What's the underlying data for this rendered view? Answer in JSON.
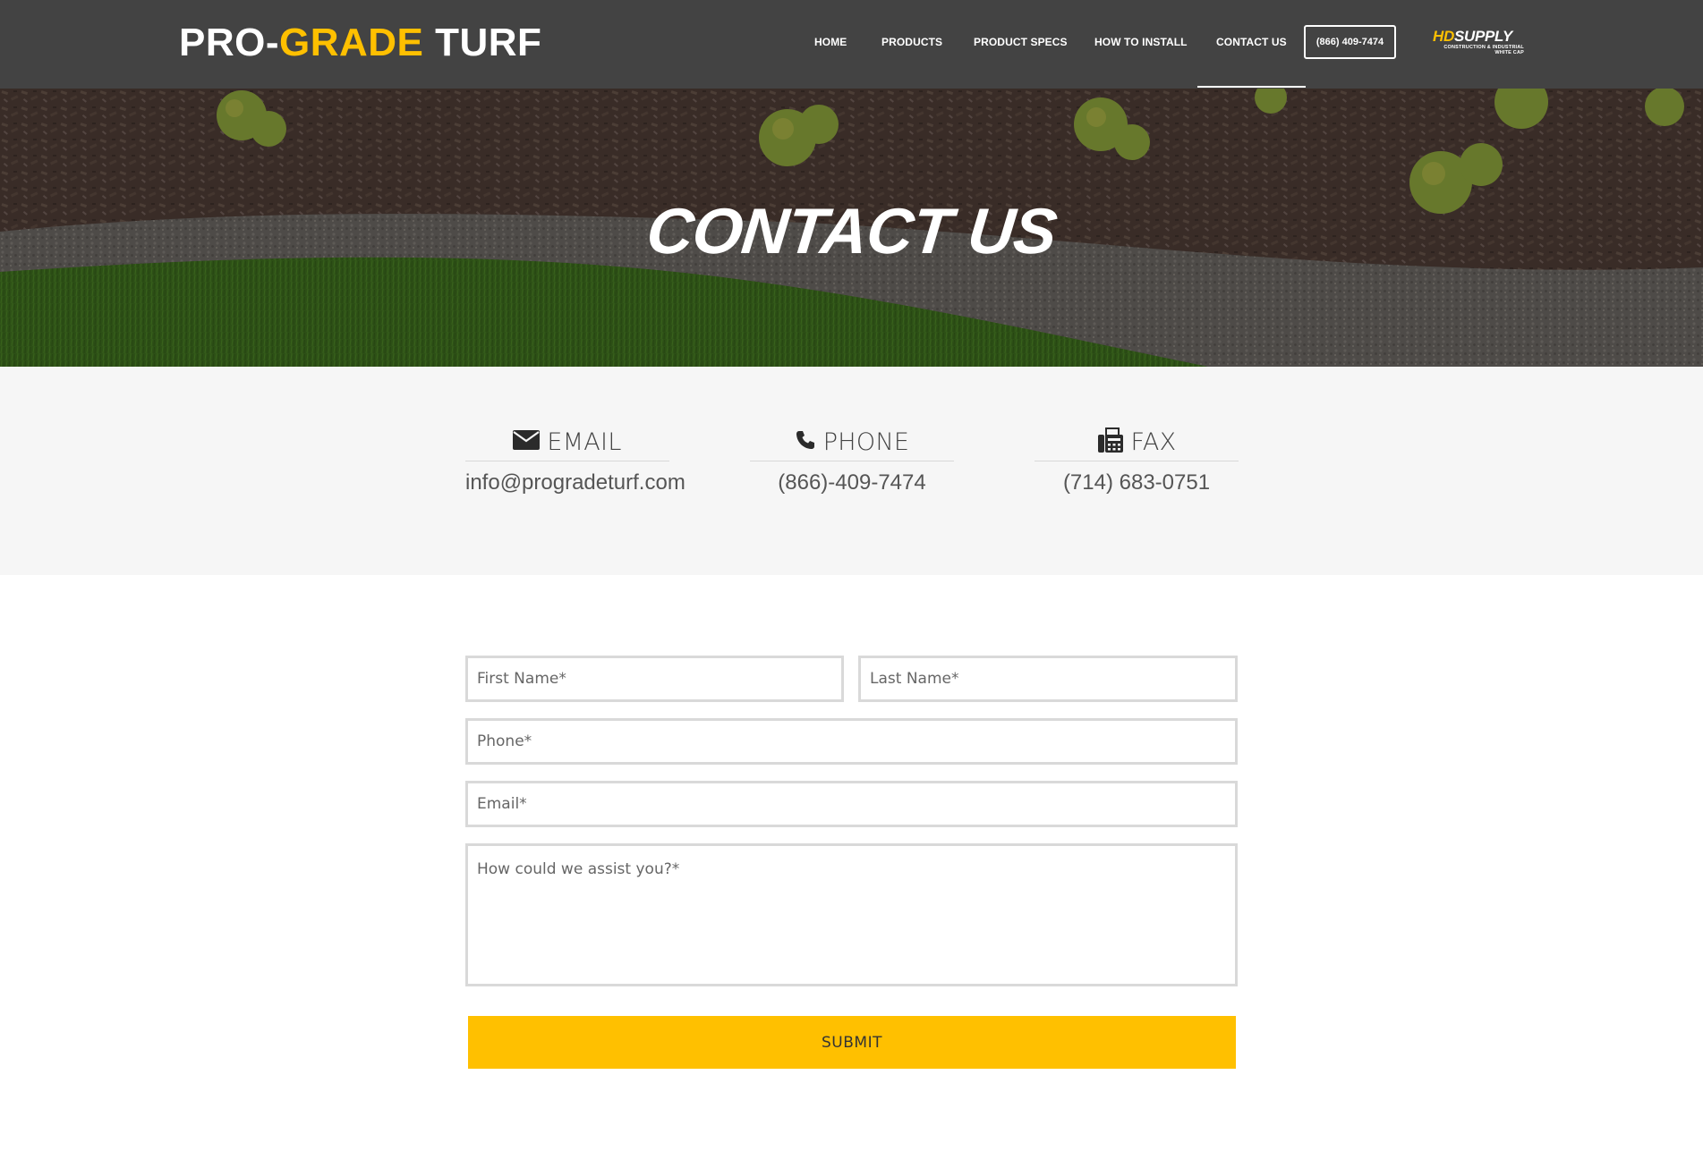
{
  "header": {
    "logo": {
      "part1": "PRO-",
      "part2": "GRADE",
      "part3": " TURF"
    },
    "nav": [
      {
        "label": "HOME"
      },
      {
        "label": "PRODUCTS"
      },
      {
        "label": "PRODUCT SPECS"
      },
      {
        "label": "HOW TO INSTALL"
      },
      {
        "label": "CONTACT US",
        "active": true
      }
    ],
    "phone_button": "(866) 409-7474",
    "partner": {
      "brand_hd": "HD",
      "brand_rest": "SUPPLY",
      "sub1": "CONSTRUCTION & INDUSTRIAL",
      "sub2": "WHITE CAP"
    }
  },
  "hero": {
    "title": "CONTACT US"
  },
  "contact_info": [
    {
      "icon": "envelope-icon",
      "label": "EMAIL",
      "value": "info@progradeturf.com"
    },
    {
      "icon": "phone-icon",
      "label": "PHONE",
      "value": "(866)-409-7474"
    },
    {
      "icon": "fax-icon",
      "label": "FAX",
      "value": "(714) 683-0751"
    }
  ],
  "form": {
    "first_name_placeholder": "First Name*",
    "last_name_placeholder": "Last Name*",
    "phone_placeholder": "Phone*",
    "email_placeholder": "Email*",
    "message_placeholder": "How could we assist you?*",
    "submit_label": "SUBMIT"
  },
  "colors": {
    "header_bg": "#434343",
    "accent": "#ffc000",
    "info_band_bg": "#f6f6f6",
    "field_border": "#d9d9d9"
  }
}
